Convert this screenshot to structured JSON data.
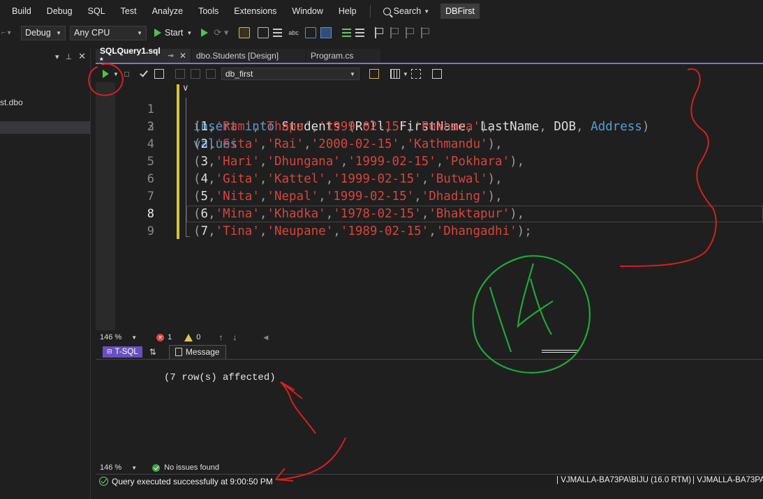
{
  "menubar": {
    "items": [
      "Build",
      "Debug",
      "SQL",
      "Test",
      "Analyze",
      "Tools",
      "Extensions",
      "Window",
      "Help"
    ],
    "search_label": "Search",
    "solution_name": "DBFirst"
  },
  "toolbar": {
    "config": "Debug",
    "platform": "Any CPU",
    "start_label": "Start"
  },
  "left_panel": {
    "item_fragment": "st.dbo"
  },
  "doc_tabs": [
    {
      "label": "SQLQuery1.sql *",
      "active": true
    },
    {
      "label": "dbo.Students [Design]",
      "active": false
    },
    {
      "label": "Program.cs",
      "active": false
    }
  ],
  "sql_toolbar": {
    "database": "db_first"
  },
  "editor": {
    "line_numbers": [
      "1",
      "2",
      "3",
      "4",
      "5",
      "6",
      "7",
      "8",
      "9"
    ],
    "current_line": 8,
    "line1": {
      "insert": "insert",
      "into": "into",
      "table": "Students",
      "open": "(",
      "c1": "Roll",
      "c2": "FirstName",
      "c3": "LastName",
      "c4": "DOB",
      "c5": "Address",
      "close": ")"
    },
    "line2": "values",
    "rows": [
      {
        "num": "1",
        "first": "'Ram'",
        "last": "'Thapa'",
        "dob": "'1999-02-15'",
        "addr": "'Pokhara'",
        "end": "),"
      },
      {
        "num": "2",
        "first": "'Sita'",
        "last": "'Rai'",
        "dob": "'2000-02-15'",
        "addr": "'Kathmandu'",
        "end": "),"
      },
      {
        "num": "3",
        "first": "'Hari'",
        "last": "'Dhungana'",
        "dob": "'1999-02-15'",
        "addr": "'Pokhara'",
        "end": "),"
      },
      {
        "num": "4",
        "first": "'Gita'",
        "last": "'Kattel'",
        "dob": "'1999-02-15'",
        "addr": "'Butwal'",
        "end": "),"
      },
      {
        "num": "5",
        "first": "'Nita'",
        "last": "'Nepal'",
        "dob": "'1999-02-15'",
        "addr": "'Dhading'",
        "end": "),"
      },
      {
        "num": "6",
        "first": "'Mina'",
        "last": "'Khadka'",
        "dob": "'1978-02-15'",
        "addr": "'Bhaktapur'",
        "end": "),"
      },
      {
        "num": "7",
        "first": "'Tina'",
        "last": "'Neupane'",
        "dob": "'1989-02-15'",
        "addr": "'Dhangadhi'",
        "end": ");"
      }
    ]
  },
  "editor_status": {
    "zoom": "146 %",
    "errors": "1",
    "warnings": "0"
  },
  "results_tabs": {
    "tsql_label": "T-SQL",
    "message_label": "Message"
  },
  "results": {
    "message": "(7 row(s) affected)"
  },
  "results_status": {
    "zoom": "146 %",
    "issues": "No issues found"
  },
  "query_status": {
    "message": "Query executed successfully at 9:00:50 PM",
    "server": "VJMALLA-BA73PA\\BIJU (16.0 RTM)",
    "server2": "VJMALLA-BA73PA"
  },
  "annotation": {
    "number": "14",
    "red": "#d62020",
    "green": "#1fa83a"
  },
  "colors": {
    "keyword": "#569cd6",
    "string": "#d6453d",
    "accent": "#6a4fc1"
  }
}
